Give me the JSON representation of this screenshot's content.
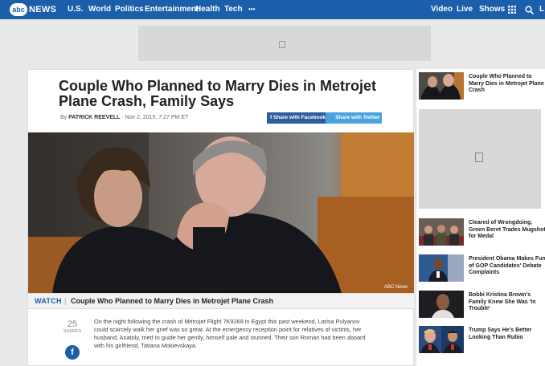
{
  "nav": {
    "logo_mark": "abc",
    "logo_text": "NEWS",
    "left_items": [
      "U.S.",
      "World",
      "Politics",
      "Entertainment",
      "Health",
      "Tech",
      "•••"
    ],
    "right_items": [
      "Video",
      "Live",
      "Shows"
    ],
    "icons": [
      "grid-icon",
      "search-icon",
      "user-icon"
    ],
    "user_initial": "L"
  },
  "colors": {
    "brand": "#1b5ea9",
    "facebook": "#2f5e9c",
    "twitter": "#4aa3df"
  },
  "article": {
    "headline": "Couple Who Planned to Marry Dies in Metrojet Plane Crash, Family Says",
    "byline_prefix": "By",
    "author": "PATRICK REEVELL",
    "date": "Nov 2, 2015, 7:27 PM ET",
    "share_facebook": "Share with Facebook",
    "share_twitter": "Share with Twitter",
    "photo_credit": "ABC News",
    "watch_label": "WATCH",
    "watch_title": "Couple Who Planned to Marry Dies in Metrojet Plane Crash",
    "share_count": "25",
    "share_count_label": "SHARES",
    "body": "On the night following the crash of Metrojet Flight 7K9268 in Egypt this past weekend, Larisa Pulyanov could scarcely walk her grief was so great. At the emergency reception point for relatives of victims, her husband, Anatoly, tried to guide her gently, himself pale and stunned. Their son Roman had been aboard with his girlfriend, Tatiana Mokievskaya."
  },
  "sidebar": {
    "items": [
      {
        "caption": "Couple Who Planned to Marry Dies in Metrojet Plane Crash"
      },
      {
        "caption": "Cleared of Wrongdoing, Green Beret Trades Mugshot for Medal"
      },
      {
        "caption": "President Obama Makes Fun of GOP Candidates' Debate Complaints"
      },
      {
        "caption": "Bobbi Kristina Brown's Family Knew She Was 'In Trouble'"
      },
      {
        "caption": "Trump Says He's Better Looking Than Rubio"
      }
    ]
  }
}
